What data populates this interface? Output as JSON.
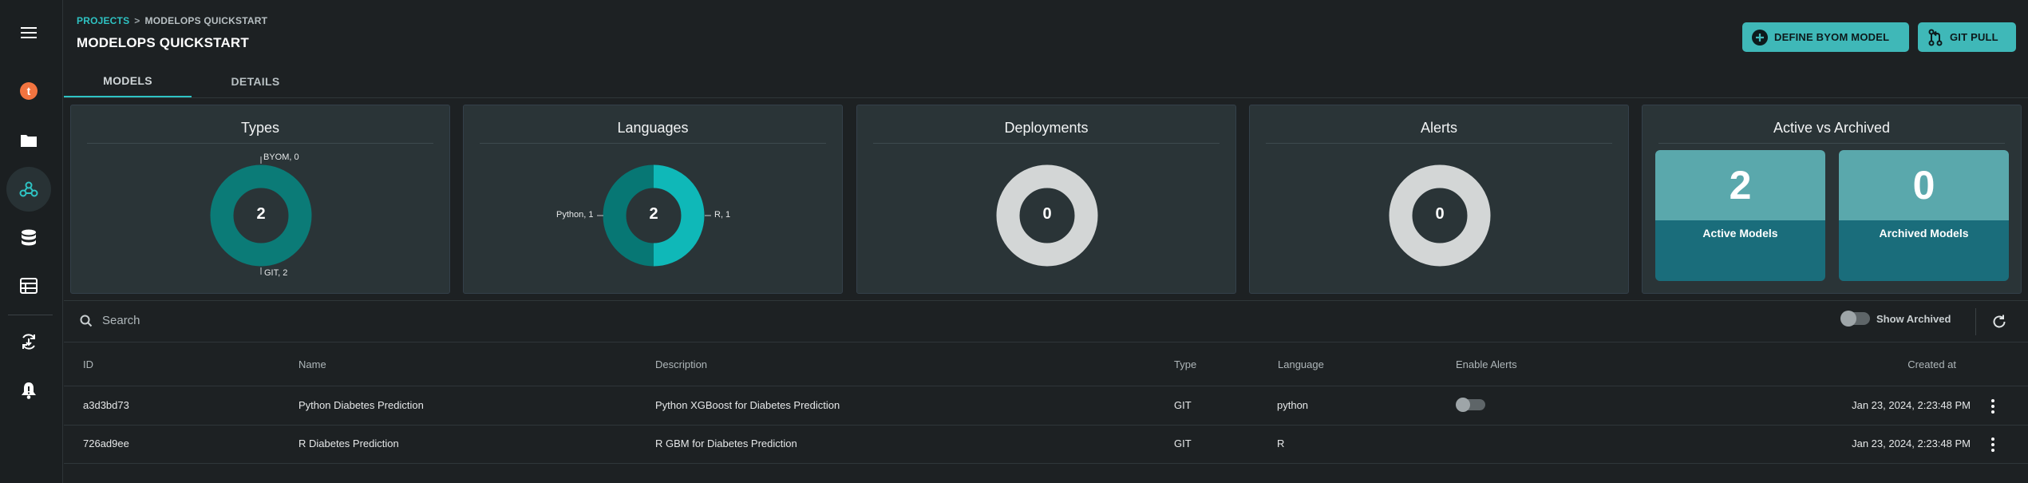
{
  "breadcrumb": {
    "root": "PROJECTS",
    "sep": ">",
    "current": "MODELOPS QUICKSTART"
  },
  "page_title": "MODELOPS QUICKSTART",
  "header_buttons": {
    "define": "DEFINE BYOM MODEL",
    "git_pull": "GIT PULL"
  },
  "tabs": [
    {
      "label": "MODELS",
      "active": true
    },
    {
      "label": "DETAILS",
      "active": false
    }
  ],
  "sidebar": {
    "items": [
      "menu-icon",
      "teradata-logo-icon",
      "folder-icon",
      "models-icon",
      "database-icon",
      "table-icon",
      "deploy-cycle-icon",
      "alert-bell-icon"
    ]
  },
  "cards": {
    "types": {
      "title": "Types",
      "total": "2",
      "label_top": "BYOM, 0",
      "label_bottom": "GIT, 2",
      "slices": [
        {
          "name": "BYOM",
          "value": 0
        },
        {
          "name": "GIT",
          "value": 2
        }
      ]
    },
    "languages": {
      "title": "Languages",
      "total": "2",
      "label_left": "Python, 1",
      "label_right": "R, 1",
      "slices": [
        {
          "name": "Python",
          "value": 1
        },
        {
          "name": "R",
          "value": 1
        }
      ]
    },
    "deployments": {
      "title": "Deployments",
      "total": "0"
    },
    "alerts": {
      "title": "Alerts",
      "total": "0"
    },
    "active_archived": {
      "title": "Active vs Archived",
      "active_count": "2",
      "active_label": "Active Models",
      "archived_count": "0",
      "archived_label": "Archived Models"
    }
  },
  "colors": {
    "accent": "#2ec3c3",
    "git": "#0b7b77",
    "python": "#077774",
    "r": "#0fb8b8",
    "empty_ring": "#d3d6d6"
  },
  "toolbar": {
    "search_placeholder": "Search",
    "show_archived": "Show Archived"
  },
  "table": {
    "columns": [
      "ID",
      "Name",
      "Description",
      "Type",
      "Language",
      "Enable Alerts",
      "Created at"
    ],
    "rows": [
      {
        "id": "a3d3bd73",
        "name": "Python Diabetes Prediction",
        "description": "Python XGBoost for Diabetes Prediction",
        "type": "GIT",
        "language": "python",
        "alerts_toggle": true,
        "created": "Jan 23, 2024, 2:23:48 PM"
      },
      {
        "id": "726ad9ee",
        "name": "R Diabetes Prediction",
        "description": "R GBM for Diabetes Prediction",
        "type": "GIT",
        "language": "R",
        "alerts_toggle": false,
        "created": "Jan 23, 2024, 2:23:48 PM"
      }
    ]
  }
}
